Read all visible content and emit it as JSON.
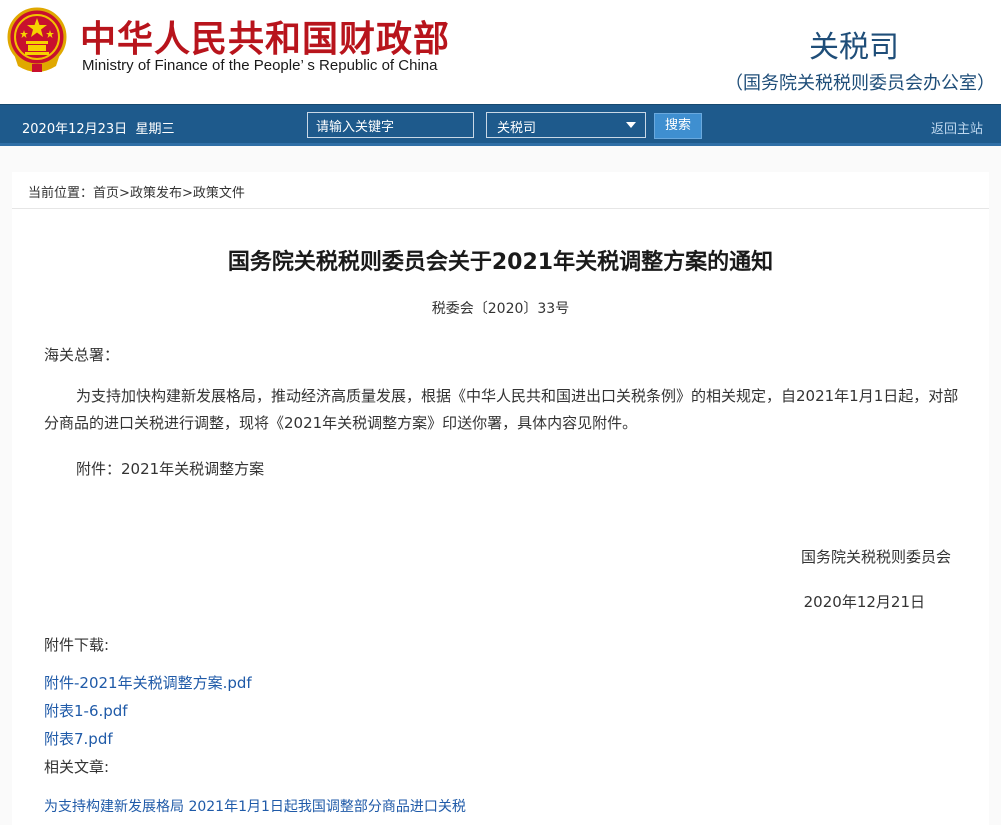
{
  "header": {
    "site_name_cn": "中华人民共和国财政部",
    "site_name_en": "Ministry of Finance of the People’ s Republic of China",
    "dept_name": "关税司",
    "dept_subtitle": "（国务院关税税则委员会办公室）"
  },
  "navbar": {
    "date": "2020年12月23日",
    "weekday": "星期三",
    "search_value": "请输入关键字",
    "scope_selected": "关税司",
    "search_button": "搜索",
    "back_home": "返回主站"
  },
  "breadcrumb": {
    "prefix": "当前位置：",
    "items": [
      "首页",
      "政策发布",
      "政策文件"
    ],
    "separator": ">"
  },
  "article": {
    "title": "国务院关税税则委员会关于2021年关税调整方案的通知",
    "doc_number": "税委会〔2020〕33号",
    "salutation": "海关总署：",
    "body": "为支持加快构建新发展格局，推动经济高质量发展，根据《中华人民共和国进出口关税条例》的相关规定，自2021年1月1日起，对部分商品的进口关税进行调整，现将《2021年关税调整方案》印送你署，具体内容见附件。",
    "attachment": "附件：2021年关税调整方案",
    "signer": "国务院关税税则委员会",
    "sign_date": "2020年12月21日"
  },
  "downloads": {
    "heading": "附件下载:",
    "files": [
      "附件-2021年关税调整方案.pdf",
      "附表1-6.pdf",
      "附表7.pdf"
    ]
  },
  "related": {
    "heading": "相关文章:",
    "articles": [
      "为支持构建新发展格局 2021年1月1日起我国调整部分商品进口关税"
    ]
  },
  "colors": {
    "brand_red": "#b8141c",
    "nav_blue": "#1e5a8c",
    "link_blue": "#1f5aa8"
  },
  "icons": {
    "emblem": "national-emblem-icon",
    "select_caret": "chevron-down-icon"
  }
}
